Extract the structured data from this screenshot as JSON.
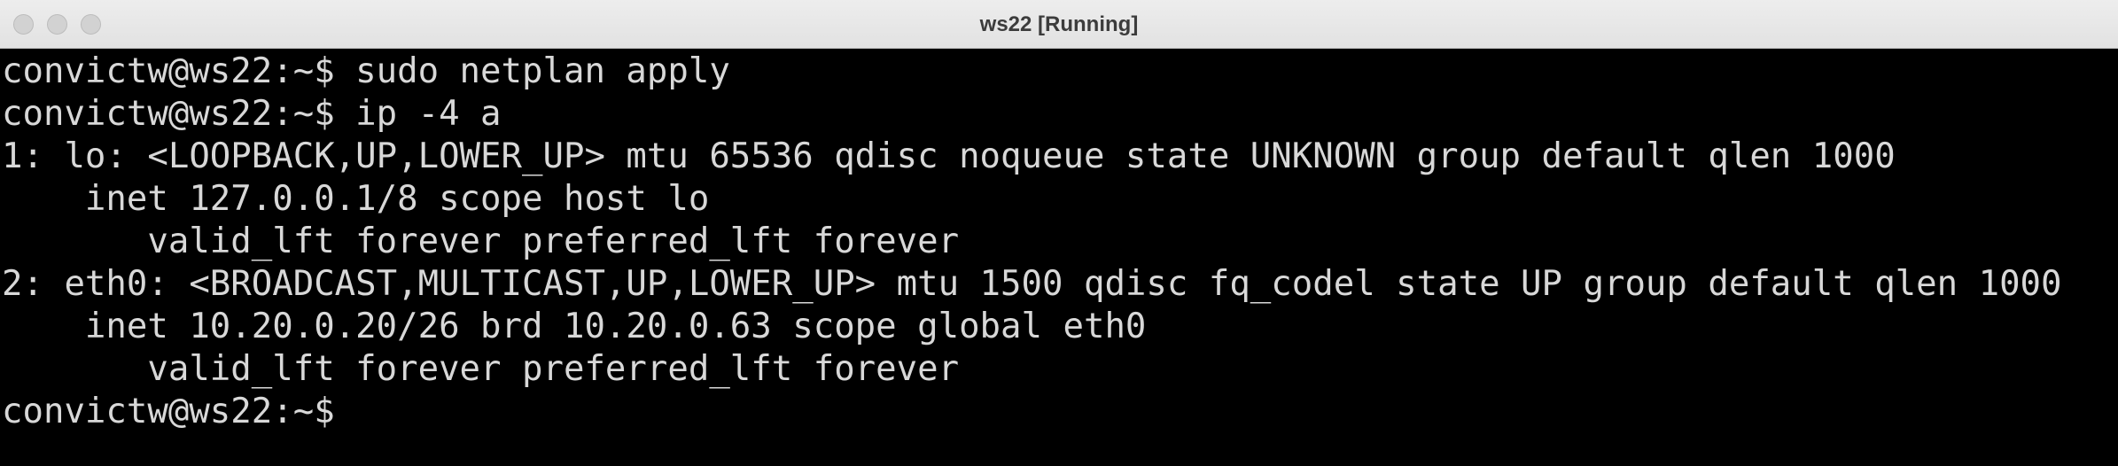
{
  "window": {
    "title": "ws22 [Running]"
  },
  "terminal": {
    "lines": [
      "convictw@ws22:~$ sudo netplan apply",
      "convictw@ws22:~$ ip -4 a",
      "1: lo: <LOOPBACK,UP,LOWER_UP> mtu 65536 qdisc noqueue state UNKNOWN group default qlen 1000",
      "    inet 127.0.0.1/8 scope host lo",
      "       valid_lft forever preferred_lft forever",
      "2: eth0: <BROADCAST,MULTICAST,UP,LOWER_UP> mtu 1500 qdisc fq_codel state UP group default qlen 1000",
      "    inet 10.20.0.20/26 brd 10.20.0.63 scope global eth0",
      "       valid_lft forever preferred_lft forever",
      "convictw@ws22:~$"
    ]
  },
  "colors": {
    "terminal_background": "#000000",
    "terminal_text": "#d8d8d8",
    "titlebar_background": "#e8e8e8"
  }
}
